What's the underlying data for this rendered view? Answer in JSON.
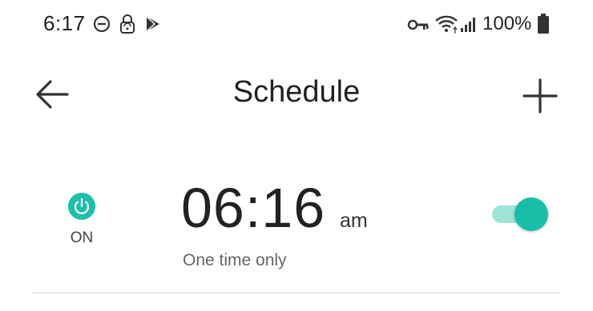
{
  "status_bar": {
    "time": "6:17",
    "battery": "100%",
    "icons": [
      "dnd-icon",
      "vpn-lock-icon",
      "play-store-icon",
      "key-icon",
      "wifi-icon",
      "signal-icon",
      "battery-icon"
    ]
  },
  "app_bar": {
    "title": "Schedule",
    "back_icon": "arrow-left-icon",
    "add_icon": "plus-icon"
  },
  "schedule": {
    "power_state": "ON",
    "time": "06:16",
    "ampm": "am",
    "repeat": "One time only",
    "enabled": true
  },
  "colors": {
    "accent": "#1ebfa9",
    "toggle_track": "#9fe3d8",
    "divider": "#dcdcdc"
  }
}
